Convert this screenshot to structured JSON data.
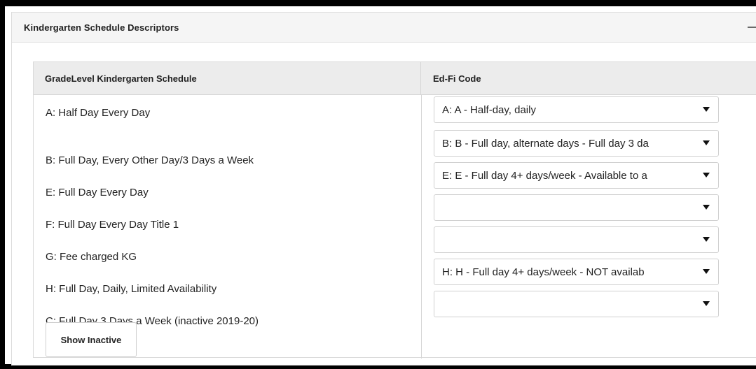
{
  "panel": {
    "title": "Kindergarten Schedule Descriptors",
    "collapse_icon": "minus-icon"
  },
  "table": {
    "columns": [
      "GradeLevel Kindergarten Schedule",
      "Ed-Fi Code"
    ],
    "rows": [
      {
        "label": "A: Half Day Every Day",
        "edfi_code": "A: A - Half-day, daily"
      },
      {
        "label": "B: Full Day, Every Other Day/3 Days a Week",
        "edfi_code": "B: B - Full day, alternate days - Full day 3 da"
      },
      {
        "label": "E: Full Day Every Day",
        "edfi_code": "E: E - Full day 4+ days/week - Available to a"
      },
      {
        "label": "F: Full Day Every Day Title 1",
        "edfi_code": ""
      },
      {
        "label": "G: Fee charged KG",
        "edfi_code": ""
      },
      {
        "label": "H: Full Day, Daily, Limited Availability",
        "edfi_code": "H: H - Full day 4+ days/week - NOT availab"
      },
      {
        "label": "C: Full Day 3 Days a Week (inactive 2019-20)",
        "edfi_code": ""
      }
    ],
    "dropdown_icon": "caret-down-icon"
  },
  "buttons": {
    "show_inactive": "Show Inactive"
  }
}
